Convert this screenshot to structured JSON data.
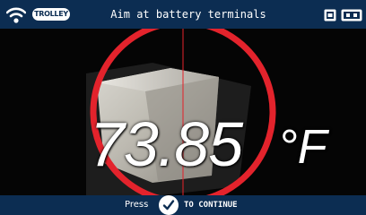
{
  "header": {
    "badge": "TROLLEY",
    "title": "Aim at battery terminals",
    "icons": [
      "wifi-icon",
      "sd-card-icon",
      "battery-icon"
    ]
  },
  "reading": {
    "value": "73.85",
    "unit": "°F"
  },
  "footer": {
    "press": "Press",
    "continue": "TO CONTINUE",
    "button_icon": "check-icon"
  },
  "colors": {
    "bar": "#0c2d52",
    "reticle": "#e3232c",
    "text": "#ffffff"
  }
}
